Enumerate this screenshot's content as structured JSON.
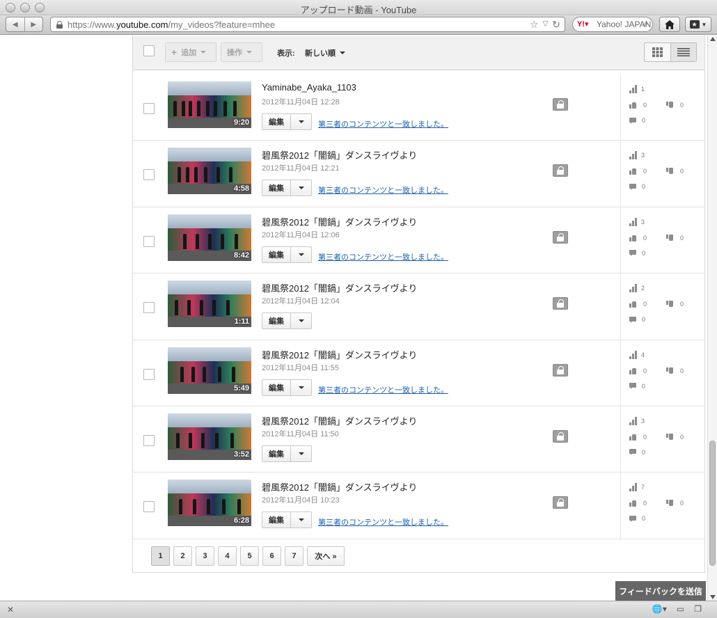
{
  "window": {
    "title": "アップロード動画 - YouTube"
  },
  "browser": {
    "url_prefix": "https://www.",
    "url_domain": "youtube.com",
    "url_path": "/my_videos?feature=mhee",
    "search_placeholder": "Yahoo! JAPAN"
  },
  "actionbar": {
    "add_label": "追加",
    "actions_label": "操作",
    "show_label": "表示:",
    "sort_value": "新しい順"
  },
  "videos": [
    {
      "title": "Yaminabe_Ayaka_1103",
      "date": "2012年11月04日 12:28",
      "duration": "9:20",
      "edit": "編集",
      "claim": "第三者のコンテンツと一致しました。",
      "views": "1",
      "likes": "0",
      "dislikes": "0",
      "comments": "0"
    },
    {
      "title": "碧風祭2012「闇鍋」ダンスライヴより",
      "date": "2012年11月04日 12:21",
      "duration": "4:58",
      "edit": "編集",
      "claim": "第三者のコンテンツと一致しました。",
      "views": "3",
      "likes": "0",
      "dislikes": "0",
      "comments": "0"
    },
    {
      "title": "碧風祭2012「闇鍋」ダンスライヴより",
      "date": "2012年11月04日 12:06",
      "duration": "8:42",
      "edit": "編集",
      "claim": "第三者のコンテンツと一致しました。",
      "views": "3",
      "likes": "0",
      "dislikes": "0",
      "comments": "0"
    },
    {
      "title": "碧風祭2012「闇鍋」ダンスライヴより",
      "date": "2012年11月04日 12:04",
      "duration": "1:11",
      "edit": "編集",
      "claim": "",
      "views": "2",
      "likes": "0",
      "dislikes": "0",
      "comments": "0"
    },
    {
      "title": "碧風祭2012「闇鍋」ダンスライヴより",
      "date": "2012年11月04日 11:55",
      "duration": "5:49",
      "edit": "編集",
      "claim": "第三者のコンテンツと一致しました。",
      "views": "4",
      "likes": "0",
      "dislikes": "0",
      "comments": "0"
    },
    {
      "title": "碧風祭2012「闇鍋」ダンスライヴより",
      "date": "2012年11月04日 11:50",
      "duration": "3:52",
      "edit": "編集",
      "claim": "",
      "views": "3",
      "likes": "0",
      "dislikes": "0",
      "comments": "0"
    },
    {
      "title": "碧風祭2012「闇鍋」ダンスライヴより",
      "date": "2012年11月04日 10:23",
      "duration": "6:28",
      "edit": "編集",
      "claim": "第三者のコンテンツと一致しました。",
      "views": "7",
      "likes": "0",
      "dislikes": "0",
      "comments": "0"
    }
  ],
  "pagination": {
    "pages": [
      "1",
      "2",
      "3",
      "4",
      "5",
      "6",
      "7"
    ],
    "current": "1",
    "next_label": "次へ »"
  },
  "feedback_label": "フィードバックを送信",
  "colors": {
    "link": "#1a5fb4",
    "feedback_bg": "#666666"
  }
}
